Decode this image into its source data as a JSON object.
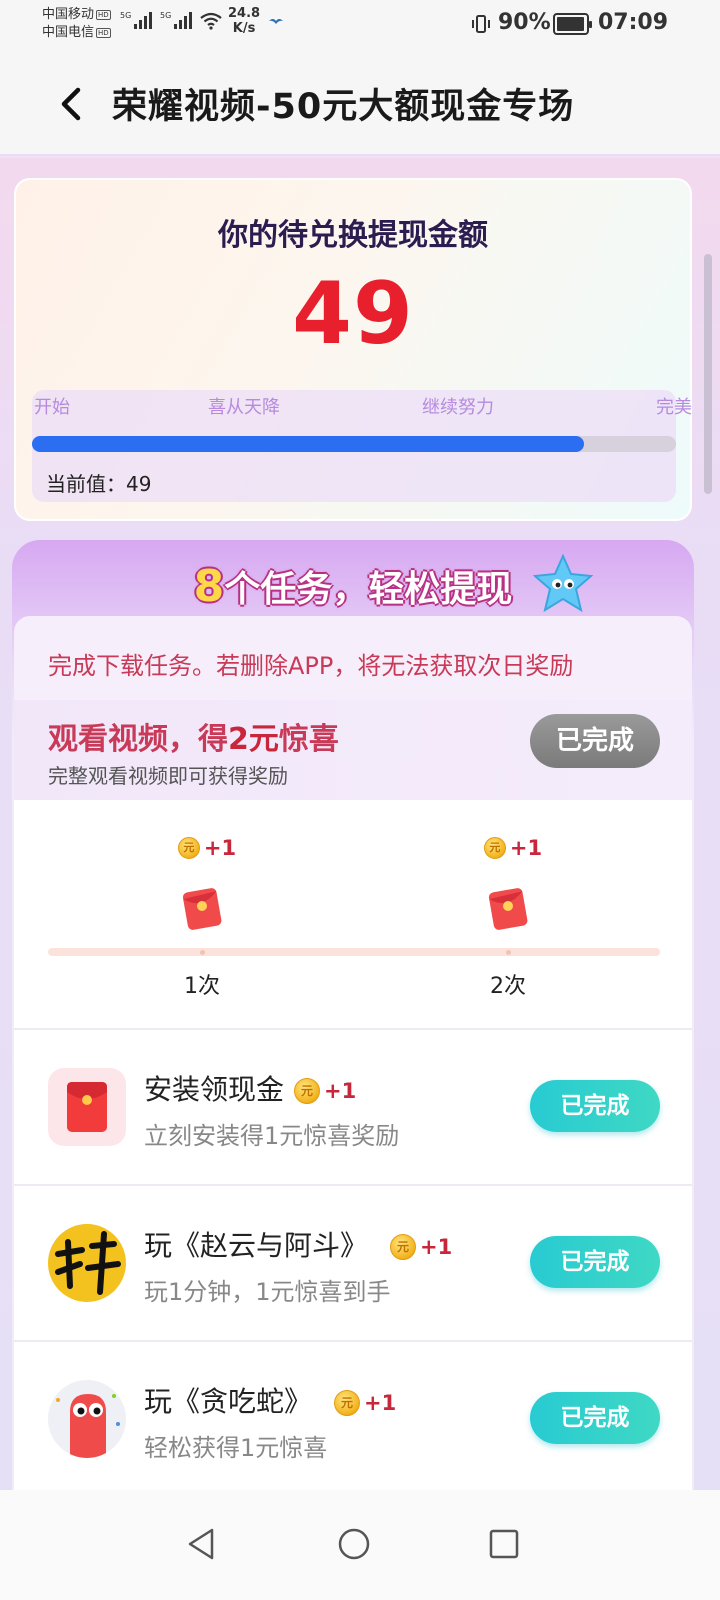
{
  "status_bar": {
    "carrier1": "中国移动",
    "carrier2": "中国电信",
    "hd": "HD",
    "network1": "5G",
    "network2": "5G",
    "speed_value": "24.8",
    "speed_unit": "K/s",
    "battery_percent": "90%",
    "battery_level": 0.9,
    "time": "07:09"
  },
  "header": {
    "title": "荣耀视频-50元大额现金专场"
  },
  "amount_card": {
    "title": "你的待兑换提现金额",
    "value": "49",
    "milestones": [
      "开始",
      "喜从天降",
      "继续努力",
      "完美"
    ],
    "progress": 0.98,
    "current_label": "当前值：49"
  },
  "tasks": {
    "banner_num": "8",
    "banner_text": "个任务，轻松提现",
    "notice": "完成下载任务。若删除APP，将无法获取次日奖励",
    "video": {
      "title_prefix": "观看视频，得",
      "title_amount": "2元",
      "title_suffix": "惊喜",
      "subtitle": "完整观看视频即可获得奖励",
      "button": "已完成",
      "rewards": [
        {
          "coin": "元",
          "plus": "+1",
          "times": "1次"
        },
        {
          "coin": "元",
          "plus": "+1",
          "times": "2次"
        }
      ]
    },
    "apps": [
      {
        "name": "安装领现金",
        "coin": "元",
        "plus": "+1",
        "subtitle": "立刻安装得1元惊喜奖励",
        "button": "已完成"
      },
      {
        "name": "玩《赵云与阿斗》",
        "coin": "元",
        "plus": "+1",
        "subtitle": "玩1分钟，1元惊喜到手",
        "button": "已完成"
      },
      {
        "name": "玩《贪吃蛇》",
        "coin": "元",
        "plus": "+1",
        "subtitle": "轻松获得1元惊喜",
        "button": "已完成"
      }
    ],
    "colors": {
      "accent_red": "#e8202e",
      "progress_blue": "#2b6ef2",
      "button_teal": "#28cbd2",
      "button_grey": "#8a8a8a"
    }
  },
  "icons": [
    "back-icon",
    "wifi-icon",
    "vibrate-icon",
    "battery-icon",
    "coin-icon",
    "red-envelope-icon",
    "star-mascot-icon",
    "nav-back-icon",
    "nav-home-icon",
    "nav-recents-icon"
  ]
}
